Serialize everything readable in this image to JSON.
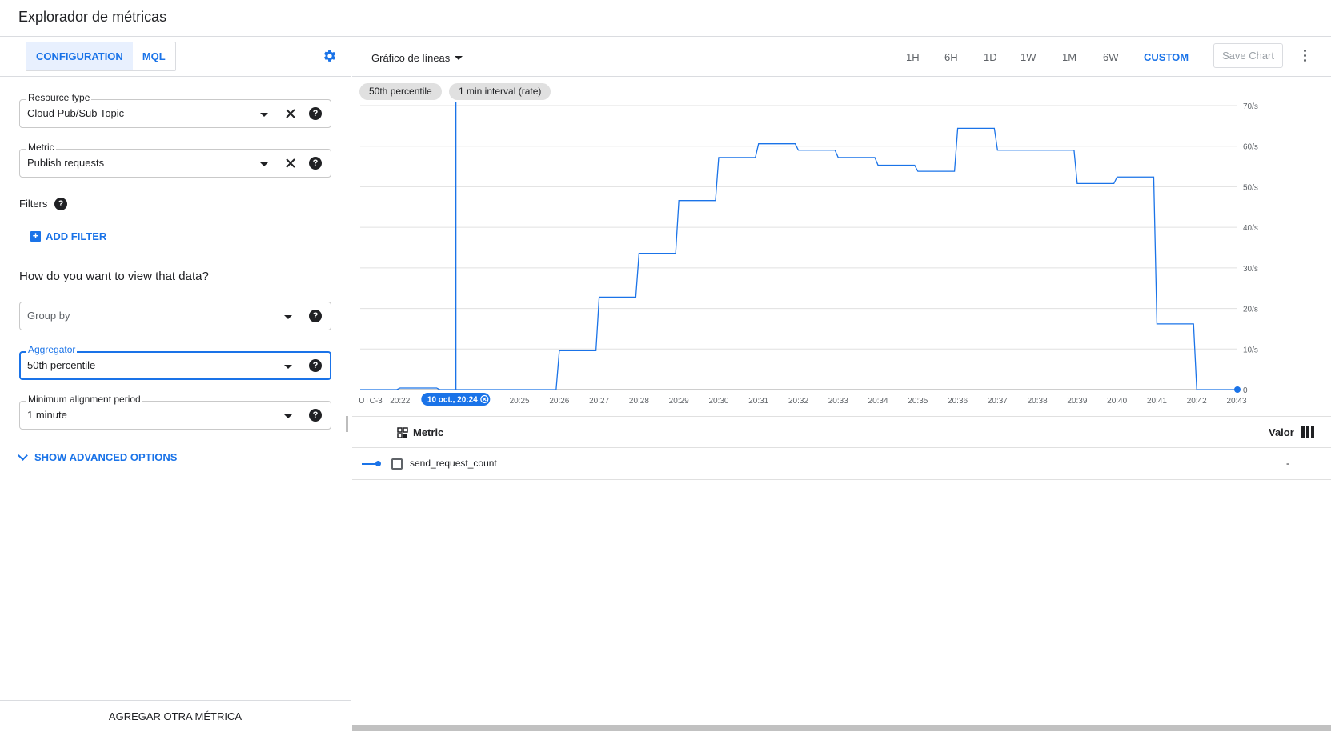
{
  "page": {
    "title": "Explorador de métricas"
  },
  "left": {
    "tabs": [
      {
        "label": "CONFIGURATION"
      },
      {
        "label": "MQL"
      }
    ],
    "resource_type": {
      "label": "Resource type",
      "value": "Cloud Pub/Sub Topic"
    },
    "metric": {
      "label": "Metric",
      "value": "Publish requests"
    },
    "filters_label": "Filters",
    "add_filter_label": "ADD FILTER",
    "view_question": "How do you want to view that data?",
    "group_by": {
      "placeholder": "Group by"
    },
    "aggregator": {
      "label": "Aggregator",
      "value": "50th percentile"
    },
    "alignment": {
      "label": "Minimum alignment period",
      "value": "1 minute"
    },
    "advanced_label": "SHOW ADVANCED OPTIONS",
    "add_metric_label": "AGREGAR OTRA MÉTRICA"
  },
  "toolbar": {
    "chart_type": "Gráfico de líneas",
    "ranges": [
      "1H",
      "6H",
      "1D",
      "1W",
      "1M",
      "6W",
      "CUSTOM"
    ],
    "active_range": "CUSTOM",
    "save_label": "Save Chart"
  },
  "chips": [
    "50th percentile",
    "1 min interval (rate)"
  ],
  "chart_data": {
    "type": "line",
    "x_ticks": [
      "UTC-3",
      "20:22",
      "20:23",
      "20:24",
      "20:25",
      "20:26",
      "20:27",
      "20:28",
      "20:29",
      "20:30",
      "20:31",
      "20:32",
      "20:33",
      "20:34",
      "20:35",
      "20:36",
      "20:37",
      "20:38",
      "20:39",
      "20:40",
      "20:41",
      "20:42",
      "20:43"
    ],
    "y_ticks": [
      "0",
      "10/s",
      "20/s",
      "30/s",
      "40/s",
      "50/s",
      "60/s",
      "70/s"
    ],
    "ylim": [
      0,
      70
    ],
    "grid": true,
    "cursor_label": "10 oct., 20:24",
    "series": [
      {
        "name": "send_request_count",
        "color": "#1a73e8",
        "points": [
          [
            "20:21",
            0.0
          ],
          [
            "20:22",
            0.4
          ],
          [
            "20:23",
            0.0
          ],
          [
            "20:24",
            0.0
          ],
          [
            "20:25",
            0.0
          ],
          [
            "20:26",
            9.6
          ],
          [
            "20:27",
            22.8
          ],
          [
            "20:28",
            33.6
          ],
          [
            "20:29",
            46.6
          ],
          [
            "20:30",
            57.2
          ],
          [
            "20:31",
            60.6
          ],
          [
            "20:32",
            59.0
          ],
          [
            "20:33",
            57.2
          ],
          [
            "20:34",
            55.3
          ],
          [
            "20:35",
            53.8
          ],
          [
            "20:36",
            64.4
          ],
          [
            "20:37",
            59.0
          ],
          [
            "20:38",
            59.0
          ],
          [
            "20:39",
            50.8
          ],
          [
            "20:40",
            52.4
          ],
          [
            "20:41",
            16.2
          ],
          [
            "20:42",
            0.0
          ],
          [
            "20:43",
            0.0
          ]
        ]
      }
    ]
  },
  "legend": {
    "metric_header": "Metric",
    "value_header": "Valor",
    "rows": [
      {
        "name": "send_request_count",
        "value": "-"
      }
    ]
  }
}
